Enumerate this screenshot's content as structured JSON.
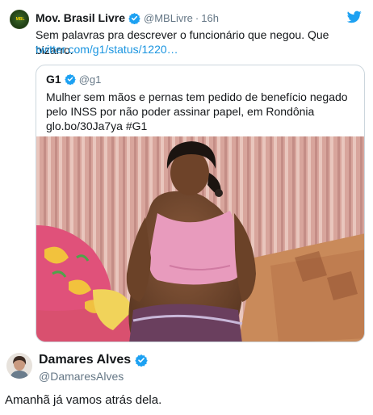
{
  "tweet": {
    "author_name": "Mov. Brasil Livre",
    "author_handle": "@MBLivre",
    "separator": "·",
    "time": "16h",
    "avatar_text": "MBL",
    "text": "Sem palavras pra descrever o funcionário que negou. Que bizarro.",
    "link": "twitter.com/g1/status/1220…"
  },
  "quoted_tweet": {
    "author_name": "G1",
    "author_handle": "@g1",
    "text": "Mulher sem mãos e pernas tem pedido de benefício negado pelo INSS por não poder assinar papel, em Rondônia glo.bo/30Ja7ya #G1"
  },
  "reply_tweet": {
    "author_name": "Damares Alves",
    "author_handle": "@DamaresAlves",
    "text": "Amanhã já vamos atrás dela."
  },
  "colors": {
    "link": "#1b95e0",
    "verified": "#1da1f2",
    "muted": "#657786",
    "border": "#ccd6dd"
  },
  "icons": {
    "verified": "verified-badge-icon",
    "twitter": "twitter-bird-icon"
  }
}
